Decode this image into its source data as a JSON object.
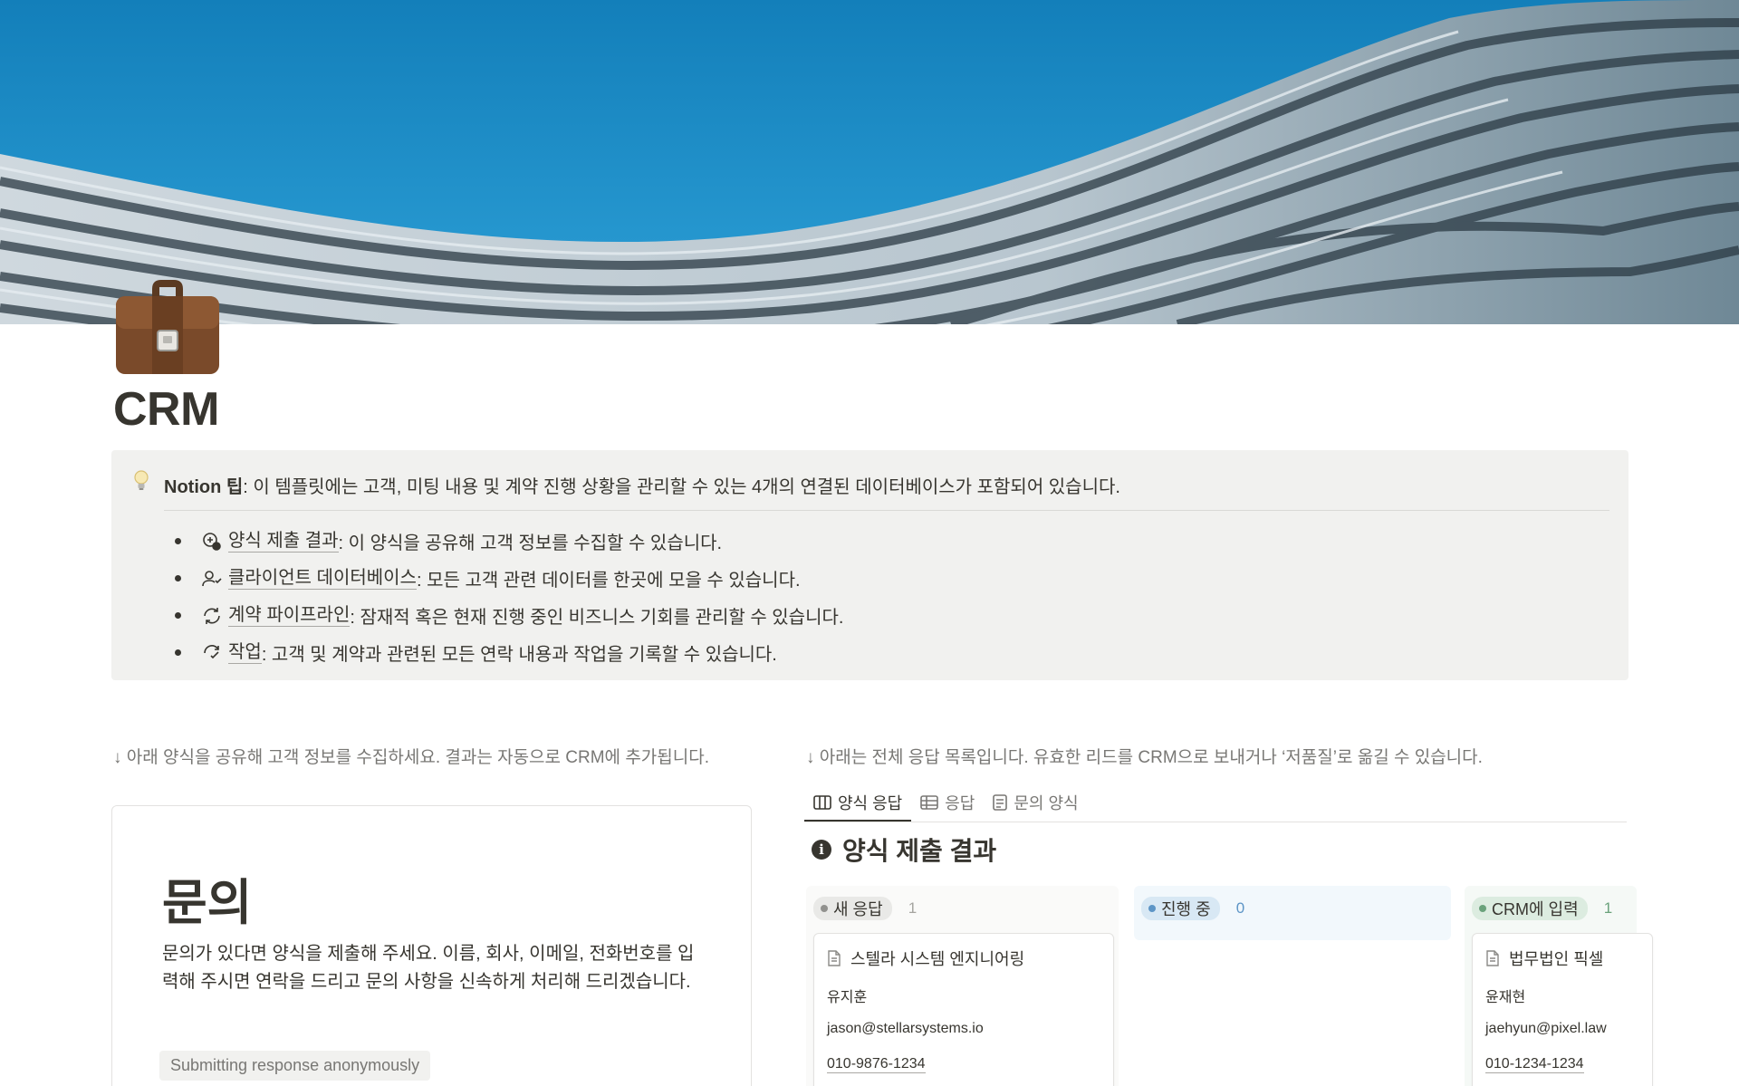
{
  "page": {
    "title": "CRM",
    "icon": "briefcase-icon"
  },
  "callout": {
    "icon": "lightbulb-icon",
    "head_bold": "Notion 팁",
    "head_text": ": 이 템플릿에는 고객, 미팅 내용 및 계약 진행 상황을 관리할 수 있는 4개의 연결된 데이터베이스가 포함되어 있습니다.",
    "bullets": [
      {
        "icon": "form-results-icon",
        "link": "양식 제출 결과",
        "text": ": 이 양식을 공유해 고객 정보를 수집할 수 있습니다."
      },
      {
        "icon": "client-icon",
        "link": "클라이언트 데이터베이스",
        "text": ": 모든 고객 관련 데이터를 한곳에 모을 수 있습니다."
      },
      {
        "icon": "pipeline-icon",
        "link": "계약 파이프라인",
        "text": ": 잠재적 혹은 현재 진행 중인 비즈니스 기회를 관리할 수 있습니다."
      },
      {
        "icon": "task-icon",
        "link": "작업",
        "text": ": 고객 및 계약과 관련된 모든 연락 내용과 작업을 기록할 수 있습니다."
      }
    ]
  },
  "left": {
    "note": "↓ 아래 양식을 공유해 고객 정보를 수집하세요. 결과는 자동으로 CRM에 추가됩니다.",
    "form": {
      "title": "문의",
      "description": "문의가 있다면 양식을 제출해 주세요. 이름, 회사, 이메일, 전화번호를 입력해 주시면 연락을 드리고 문의 사항을 신속하게 처리해 드리겠습니다.",
      "anonymous_badge": "Submitting response anonymously"
    }
  },
  "right": {
    "note": "↓ 아래는 전체 응답 목록입니다. 유효한 리드를 CRM으로 보내거나 ‘저품질’로 옮길 수 있습니다.",
    "tabs": [
      {
        "label": "양식 응답",
        "icon": "board-icon",
        "active": true
      },
      {
        "label": "응답",
        "icon": "table-icon",
        "active": false
      },
      {
        "label": "문의 양식",
        "icon": "form-icon",
        "active": false
      }
    ],
    "database_title": "양식 제출 결과",
    "database_icon": "info-icon",
    "columns": [
      {
        "label": "새 응답",
        "count": "1",
        "color": "#91918e",
        "card": {
          "name": "스텔라 시스템 엔지니어링",
          "contact": "유지훈",
          "email": "jason@stellarsystems.io",
          "phone": "010-9876-1234"
        }
      },
      {
        "label": "진행 중",
        "count": "0",
        "color": "#5d95c6"
      },
      {
        "label": "CRM에 입력",
        "count": "1",
        "color": "#6aa27b",
        "card": {
          "name": "법무법인 픽셀",
          "contact": "윤재현",
          "email": "jaehyun@pixel.law",
          "phone": "010-1234-1234"
        }
      }
    ]
  }
}
